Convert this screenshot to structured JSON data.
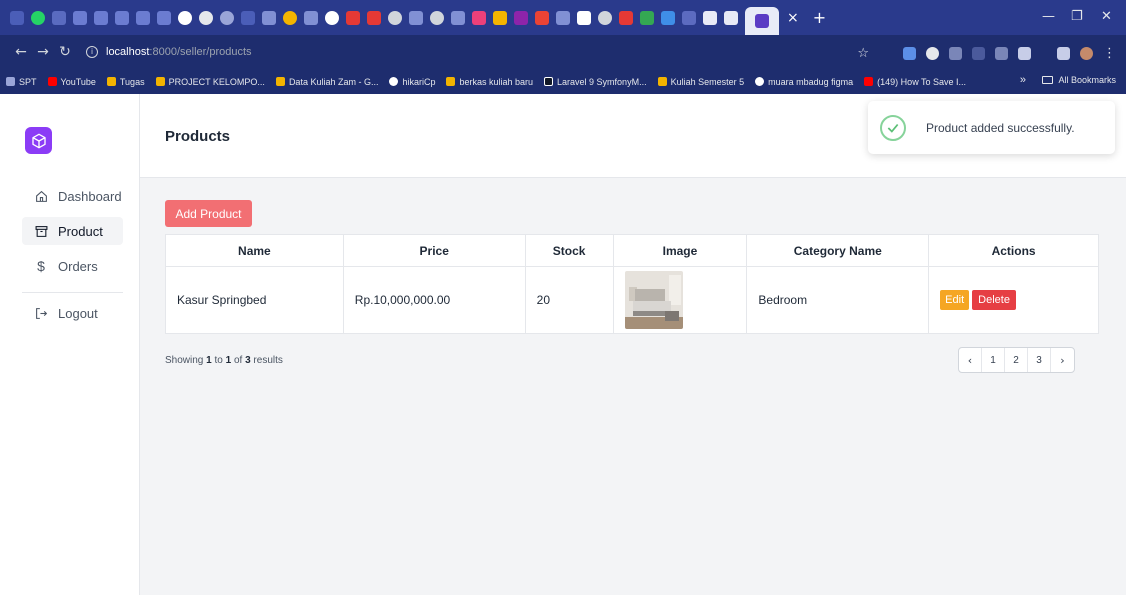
{
  "browser": {
    "url_host": "localhost",
    "url_path": ":8000/seller/products",
    "bookmarks": [
      "SPT",
      "YouTube",
      "Tugas",
      "PROJECT KELOMPO...",
      "Data Kuliah Zam - G...",
      "hikariCp",
      "berkas kuliah baru",
      "Laravel 9 SymfonyM...",
      "Kuliah Semester 5",
      "muara mbadug figma",
      "(149) How To Save I..."
    ],
    "bookmarks_overflow": "»",
    "all_bookmarks": "All Bookmarks",
    "tab_close": "×",
    "new_tab": "+"
  },
  "sidebar": {
    "items": [
      {
        "label": "Dashboard",
        "icon": "home-icon"
      },
      {
        "label": "Product",
        "icon": "box-icon"
      },
      {
        "label": "Orders",
        "icon": "dollar-icon"
      },
      {
        "label": "Logout",
        "icon": "logout-icon"
      }
    ]
  },
  "header": {
    "title": "Products"
  },
  "toast": {
    "message": "Product added successfully."
  },
  "main": {
    "add_button": "Add Product",
    "table": {
      "columns": [
        "Name",
        "Price",
        "Stock",
        "Image",
        "Category Name",
        "Actions"
      ],
      "rows": [
        {
          "name": "Kasur Springbed",
          "price": "Rp.10,000,000.00",
          "stock": "20",
          "category": "Bedroom",
          "edit": "Edit",
          "delete": "Delete"
        }
      ]
    },
    "results": {
      "prefix": "Showing",
      "from": "1",
      "to_word": "to",
      "to": "1",
      "of_word": "of",
      "total": "3",
      "suffix": "results"
    },
    "pagination": {
      "prev": "‹",
      "pages": [
        "1",
        "2",
        "3"
      ],
      "next": "›"
    }
  },
  "colors": {
    "accent": "#8b3cf6",
    "primary_button": "#f26f73",
    "edit": "#f5a623",
    "delete": "#e63e43",
    "success": "#86d39a"
  }
}
